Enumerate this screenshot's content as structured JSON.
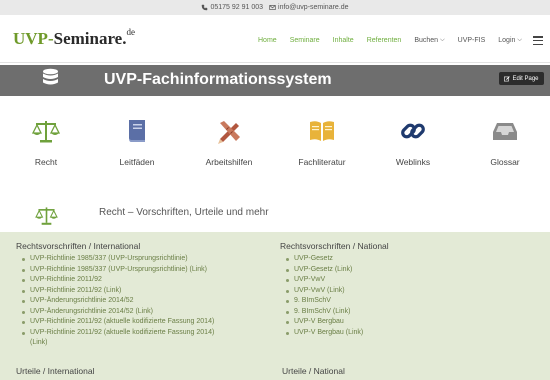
{
  "topbar": {
    "phone": "05175 92 91 003",
    "email": "info@uvp-seminare.de"
  },
  "logo": {
    "part1": "UVP-",
    "part2": "Seminare.",
    "tld": "de"
  },
  "nav": {
    "items": [
      {
        "label": "Home"
      },
      {
        "label": "Seminare"
      },
      {
        "label": "Inhalte"
      },
      {
        "label": "Referenten"
      },
      {
        "label": "Buchen"
      },
      {
        "label": "UVP-FIS"
      },
      {
        "label": "Login"
      }
    ]
  },
  "banner": {
    "title": "UVP-Fachinformationssystem",
    "edit_label": "Edit Page"
  },
  "categories": [
    {
      "label": "Recht",
      "icon": "balance-scale-icon",
      "color": "#6fa13c"
    },
    {
      "label": "Leitfäden",
      "icon": "book-icon",
      "color": "#5b6fa6"
    },
    {
      "label": "Arbeitshilfen",
      "icon": "pencil-ruler-icon",
      "color": "#b2573f"
    },
    {
      "label": "Fachliteratur",
      "icon": "open-book-icon",
      "color": "#e8b33a"
    },
    {
      "label": "Weblinks",
      "icon": "chain-link-icon",
      "color": "#1f3a6e"
    },
    {
      "label": "Glossar",
      "icon": "inbox-tray-icon",
      "color": "#8a8a8a"
    }
  ],
  "section": {
    "title": "Recht – Vorschriften, Urteile und mehr"
  },
  "lists": {
    "international": {
      "heading": "Rechtsvorschriften / International",
      "items": [
        "UVP-Richtlinie 1985/337 (UVP-Ursprungsrichtlinie)",
        "UVP-Richtlinie 1985/337 (UVP-Ursprungsrichtlinie) (Link)",
        "UVP-Richtlinie 2011/92",
        "UVP-Richtlinie 2011/92 (Link)",
        "UVP-Änderungsrichtlinie 2014/52",
        "UVP-Änderungsrichtlinie 2014/52 (Link)",
        "UVP-Richtlinie 2011/92 (aktuelle kodifizierte Fassung 2014)",
        "UVP-Richtlinie 2011/92 (aktuelle kodifizierte Fassung 2014)"
      ],
      "continuation": "(Link)"
    },
    "national": {
      "heading": "Rechtsvorschriften / National",
      "items": [
        "UVP-Gesetz",
        "UVP-Gesetz (Link)",
        "UVP-VwV",
        "UVP-VwV (Link)",
        "9. BImSchV",
        "9. BImSchV (Link)",
        "UVP-V Bergbau",
        "UVP-V Bergbau (Link)"
      ]
    }
  },
  "bottom": {
    "left": "Urteile / International",
    "right": "Urteile / National"
  }
}
